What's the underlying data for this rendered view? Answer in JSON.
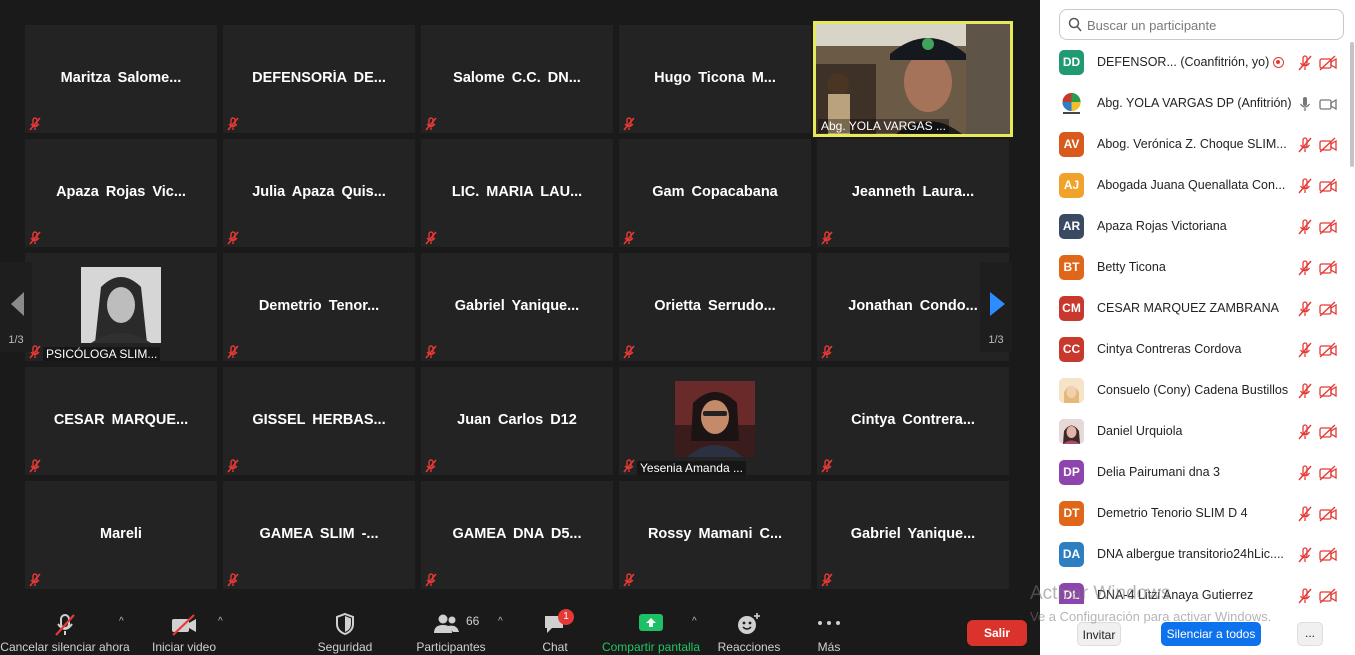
{
  "gallery": {
    "tiles": [
      {
        "name": "Maritza  Salome..."
      },
      {
        "name": "DEFENSORÍA  DE..."
      },
      {
        "name": "Salome C.C.  DN..."
      },
      {
        "name": "Hugo Ticona  M..."
      },
      {
        "label": "Abg. YOLA VARGAS ..."
      },
      {
        "name": "Apaza Rojas Vic..."
      },
      {
        "name": "Julia  Apaza  Quis..."
      },
      {
        "name": "LIC. MARIA LAU..."
      },
      {
        "name": "Gam Copacabana"
      },
      {
        "name": "Jeanneth  Laura..."
      },
      {
        "label": "PSICÓLOGA SLIM..."
      },
      {
        "name": "Demetrio  Tenor..."
      },
      {
        "name": "Gabriel  Yanique..."
      },
      {
        "name": "Orietta  Serrudo..."
      },
      {
        "name": "Jonathan  Condo..."
      },
      {
        "name": "CESAR  MARQUE..."
      },
      {
        "name": "GISSEL  HERBAS..."
      },
      {
        "name": "Juan Carlos D12"
      },
      {
        "label": "Yesenia Amanda ..."
      },
      {
        "name": "Cintya  Contrera..."
      },
      {
        "name": "Mareli"
      },
      {
        "name": "GAMEA SLIM -..."
      },
      {
        "name": "GAMEA DNA D5..."
      },
      {
        "name": "Rossy Mamani C..."
      },
      {
        "name": "Gabriel  Yanique..."
      }
    ],
    "page_left": "1/3",
    "page_right": "1/3"
  },
  "toolbar": {
    "unmute": "Cancelar silenciar ahora",
    "video": "Iniciar video",
    "security": "Seguridad",
    "participants": "Participantes",
    "participants_count": "66",
    "chat": "Chat",
    "chat_badge": "1",
    "share": "Compartir pantalla",
    "reactions": "Reacciones",
    "more": "Más",
    "exit": "Salir"
  },
  "panel": {
    "search_placeholder": "Buscar un participante",
    "participants": [
      {
        "initials": "DD",
        "color": "#1f9a72",
        "name": "DEFENSOR... (Coanfitrión, yo)"
      },
      {
        "initials": "",
        "color": "#ffffff",
        "name": "Abg. YOLA VARGAS DP (Anfitrión)"
      },
      {
        "initials": "AV",
        "color": "#d85a1c",
        "name": "Abog. Verónica Z. Choque SLIM..."
      },
      {
        "initials": "AJ",
        "color": "#f0a22b",
        "name": "Abogada Juana Quenallata Con..."
      },
      {
        "initials": "AR",
        "color": "#3b4a63",
        "name": "Apaza Rojas Victoriana"
      },
      {
        "initials": "BT",
        "color": "#e0661a",
        "name": "Betty Ticona"
      },
      {
        "initials": "CM",
        "color": "#c8382c",
        "name": "CESAR MARQUEZ ZAMBRANA"
      },
      {
        "initials": "CC",
        "color": "#c8382c",
        "name": "Cintya Contreras Cordova"
      },
      {
        "initials": "",
        "color": "#f3d9b8",
        "name": "Consuelo (Cony) Cadena Bustillos"
      },
      {
        "initials": "",
        "color": "#b08080",
        "name": "Daniel Urquiola"
      },
      {
        "initials": "DP",
        "color": "#8e44ad",
        "name": "Delia Pairumani dna 3"
      },
      {
        "initials": "DT",
        "color": "#e0661a",
        "name": "Demetrio  Tenorio SLIM D 4"
      },
      {
        "initials": "DA",
        "color": "#2d7fc1",
        "name": "DNA albergue transitorio24hLic...."
      },
      {
        "initials": "DL",
        "color": "#8e44ad",
        "name": "DNA-4 Litzi Anaya Gutierrez"
      }
    ],
    "invite": "Invitar",
    "mute_all": "Silenciar a todos",
    "more": "..."
  },
  "watermark": {
    "title": "Activar Windows",
    "subtitle": "Ve a Configuración para activar Windows."
  }
}
